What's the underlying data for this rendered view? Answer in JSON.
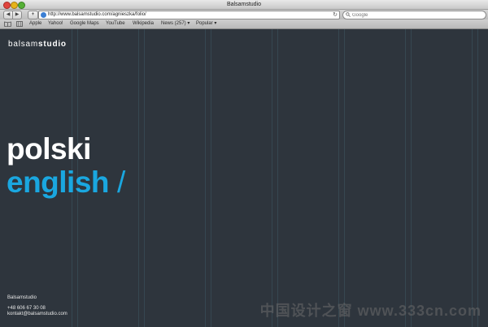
{
  "window": {
    "title": "Balsamstudio"
  },
  "toolbar": {
    "back_icon": "◀",
    "forward_icon": "▶",
    "add_icon": "+",
    "url": "http://www.balsamstudio.com/agnieszka/folio/",
    "reload_icon": "↻",
    "search_placeholder": "Google"
  },
  "bookmarks": {
    "items": [
      "Apple",
      "Yahoo!",
      "Google Maps",
      "YouTube",
      "Wikipedia",
      "News (257) ▾",
      "Popular ▾"
    ]
  },
  "page": {
    "brand_light": "balsam",
    "brand_bold": "studio",
    "lang_polish": "polski",
    "lang_english": "english",
    "lang_separator": "/",
    "footer_name": "Balsamstudio",
    "footer_phone": "+48 606 67 30 08",
    "footer_email": "kontakt@balsamstudio.com",
    "watermark": "中国设计之窗 www.333cn.com"
  },
  "colors": {
    "background": "#2e353d",
    "accent": "#1aa7e0",
    "text": "#ffffff"
  }
}
